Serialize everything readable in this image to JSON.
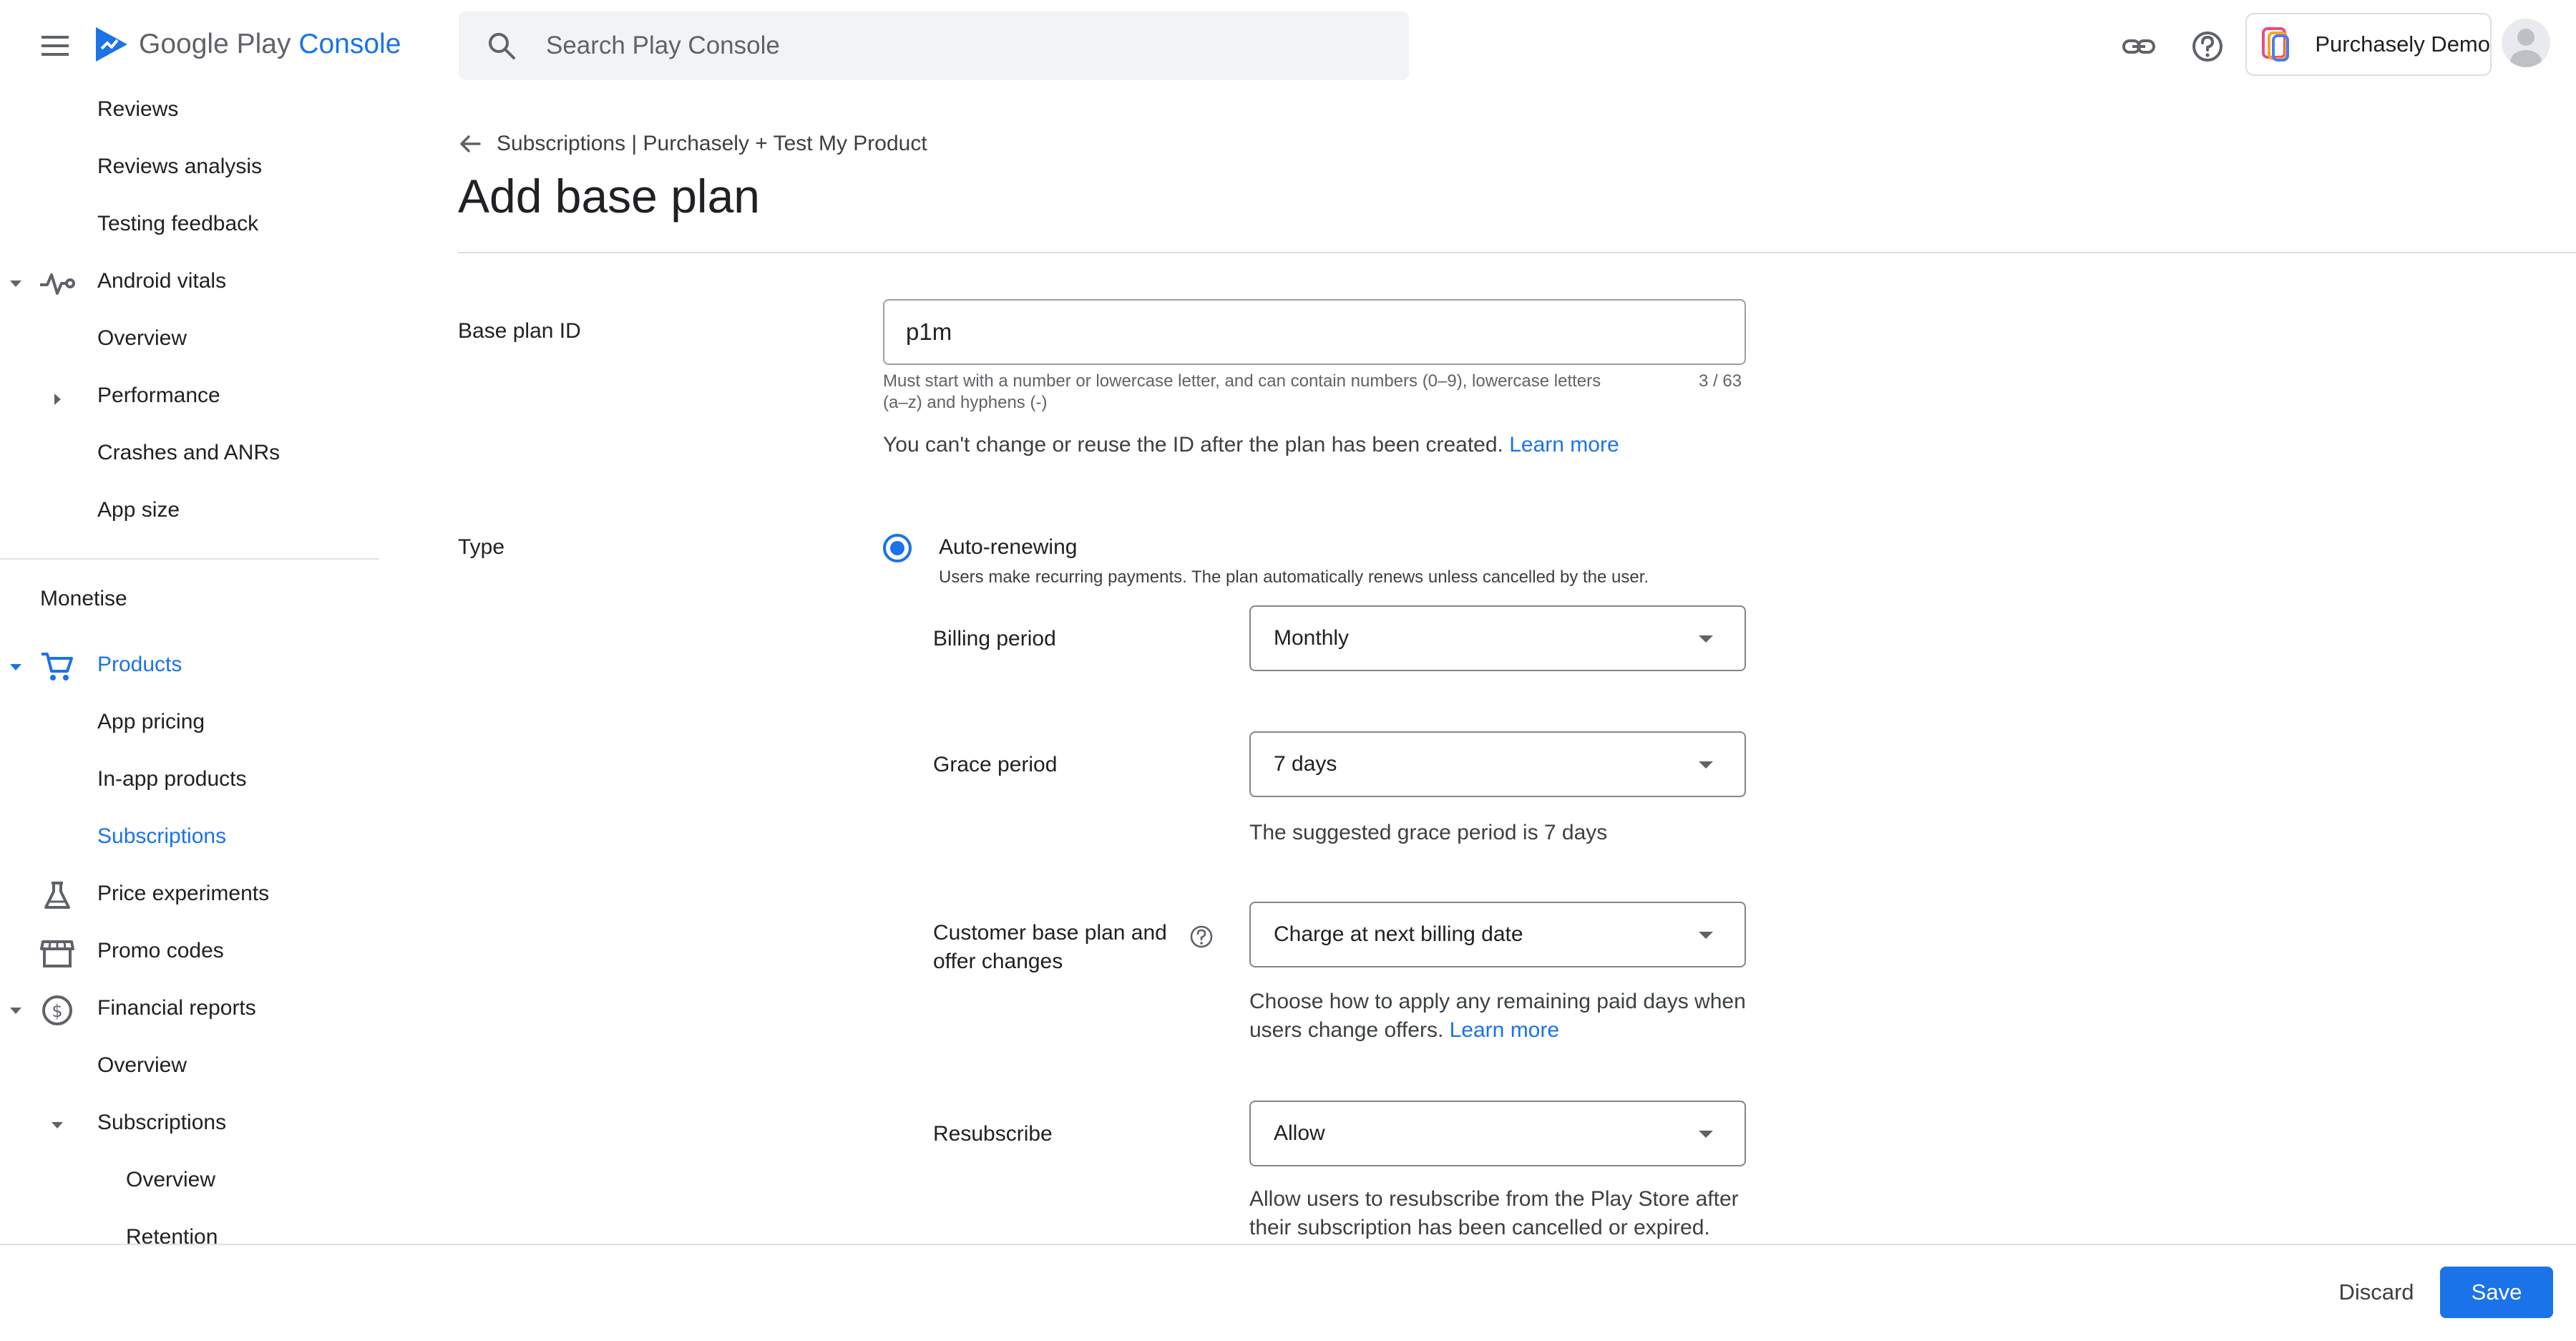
{
  "app": {
    "brand_prefix": "Google Play",
    "brand_suffix": "Console",
    "icons": {
      "menu": "menu-icon",
      "logo": "play-console-logo-icon",
      "search": "search-icon",
      "link": "link-icon",
      "help": "help-icon",
      "avatar": "avatar-icon"
    }
  },
  "search": {
    "placeholder": "Search Play Console"
  },
  "account": {
    "name": "Purchasely Demo"
  },
  "colors": {
    "accent": "#1a73e8",
    "text": "#202124",
    "muted": "#5f6368",
    "divider": "#dadce0"
  },
  "sidebar": {
    "items": [
      {
        "label": "Reviews"
      },
      {
        "label": "Reviews analysis"
      },
      {
        "label": "Testing feedback"
      },
      {
        "label": "Android vitals",
        "icon": "vitals-icon",
        "expanded": true
      },
      {
        "label": "Overview"
      },
      {
        "label": "Performance",
        "collapsed": true
      },
      {
        "label": "Crashes and ANRs"
      },
      {
        "label": "App size"
      }
    ],
    "section_title": "Monetise",
    "monetise_items": [
      {
        "label": "Products",
        "icon": "cart-icon",
        "expanded": true,
        "active": true
      },
      {
        "label": "App pricing"
      },
      {
        "label": "In-app products"
      },
      {
        "label": "Subscriptions",
        "active": true
      },
      {
        "label": "Price experiments",
        "icon": "flask-icon"
      },
      {
        "label": "Promo codes",
        "icon": "store-icon"
      },
      {
        "label": "Financial reports",
        "icon": "dollar-icon",
        "expanded": true
      },
      {
        "label": "Overview"
      },
      {
        "label": "Subscriptions",
        "expanded": true
      },
      {
        "label": "Overview"
      },
      {
        "label": "Retention"
      }
    ]
  },
  "breadcrumb": {
    "text": "Subscriptions | Purchasely + Test My Product"
  },
  "page": {
    "title": "Add base plan"
  },
  "form": {
    "base_plan_id": {
      "label": "Base plan ID",
      "value": "p1m",
      "helper_line1": "Must start with a number or lowercase letter, and can contain numbers (0–9), lowercase letters",
      "helper_line2": "(a–z) and hyphens (-)",
      "counter": "3 / 63",
      "note": "You can't change or reuse the ID after the plan has been created.",
      "note_link": "Learn more"
    },
    "type": {
      "label": "Type",
      "option_label": "Auto-renewing",
      "option_desc": "Users make recurring payments. The plan automatically renews unless cancelled by the user.",
      "selected": true
    },
    "billing_period": {
      "label": "Billing period",
      "value": "Monthly"
    },
    "grace_period": {
      "label": "Grace period",
      "value": "7 days",
      "note": "The suggested grace period is 7 days"
    },
    "customer_changes": {
      "label_line1": "Customer base plan and",
      "label_line2": "offer changes",
      "value": "Charge at next billing date",
      "note_line1": "Choose how to apply any remaining paid days when",
      "note_line2": "users change offers.",
      "note_link": "Learn more"
    },
    "resubscribe": {
      "label": "Resubscribe",
      "value": "Allow",
      "note_line1": "Allow users to resubscribe from the Play Store after",
      "note_line2": "their subscription has been cancelled or expired."
    }
  },
  "footer": {
    "discard": "Discard",
    "save": "Save"
  }
}
